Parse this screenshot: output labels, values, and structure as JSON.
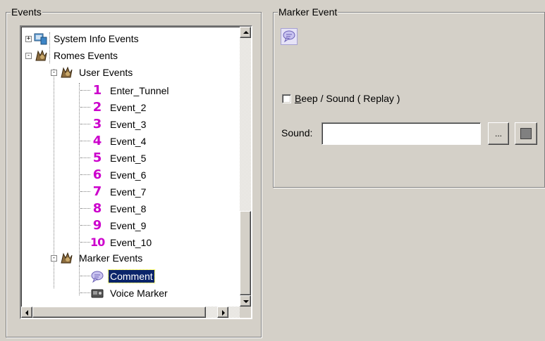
{
  "events_group": {
    "title": "Events",
    "tree": [
      {
        "label": "System Info Events",
        "expander": "+",
        "icon": "system-info-icon"
      },
      {
        "label": "Romes Events",
        "expander": "-",
        "icon": "romes-events-icon"
      },
      {
        "label": "User Events",
        "expander": "-",
        "icon": "user-events-icon"
      },
      {
        "label": "Enter_Tunnel",
        "badge": "1",
        "icon": "number-1-icon"
      },
      {
        "label": "Event_2",
        "badge": "2",
        "icon": "number-2-icon"
      },
      {
        "label": "Event_3",
        "badge": "3",
        "icon": "number-3-icon"
      },
      {
        "label": "Event_4",
        "badge": "4",
        "icon": "number-4-icon"
      },
      {
        "label": "Event_5",
        "badge": "5",
        "icon": "number-5-icon"
      },
      {
        "label": "Event_6",
        "badge": "6",
        "icon": "number-6-icon"
      },
      {
        "label": "Event_7",
        "badge": "7",
        "icon": "number-7-icon"
      },
      {
        "label": "Event_8",
        "badge": "8",
        "icon": "number-8-icon"
      },
      {
        "label": "Event_9",
        "badge": "9",
        "icon": "number-9-icon"
      },
      {
        "label": "Event_10",
        "badge": "10",
        "icon": "number-10-icon"
      },
      {
        "label": "Marker Events",
        "expander": "-",
        "icon": "marker-events-icon"
      },
      {
        "label": "Comment",
        "icon": "speech-bubble-icon",
        "selected": true
      },
      {
        "label": "Voice Marker",
        "icon": "voice-recorder-icon"
      }
    ]
  },
  "marker_group": {
    "title": "Marker Event",
    "event_icon": "speech-bubble-icon",
    "beep_checkbox": {
      "label_accel": "B",
      "label_rest": "eep / Sound ( Replay )",
      "checked": false
    },
    "sound": {
      "label": "Sound:",
      "value": "",
      "browse_label": "...",
      "stop_icon": "stop-square-icon"
    }
  },
  "colors": {
    "dialog_bg": "#d4d0c8",
    "selection_bg": "#0a246a",
    "number_badge": "#cc00cc"
  }
}
